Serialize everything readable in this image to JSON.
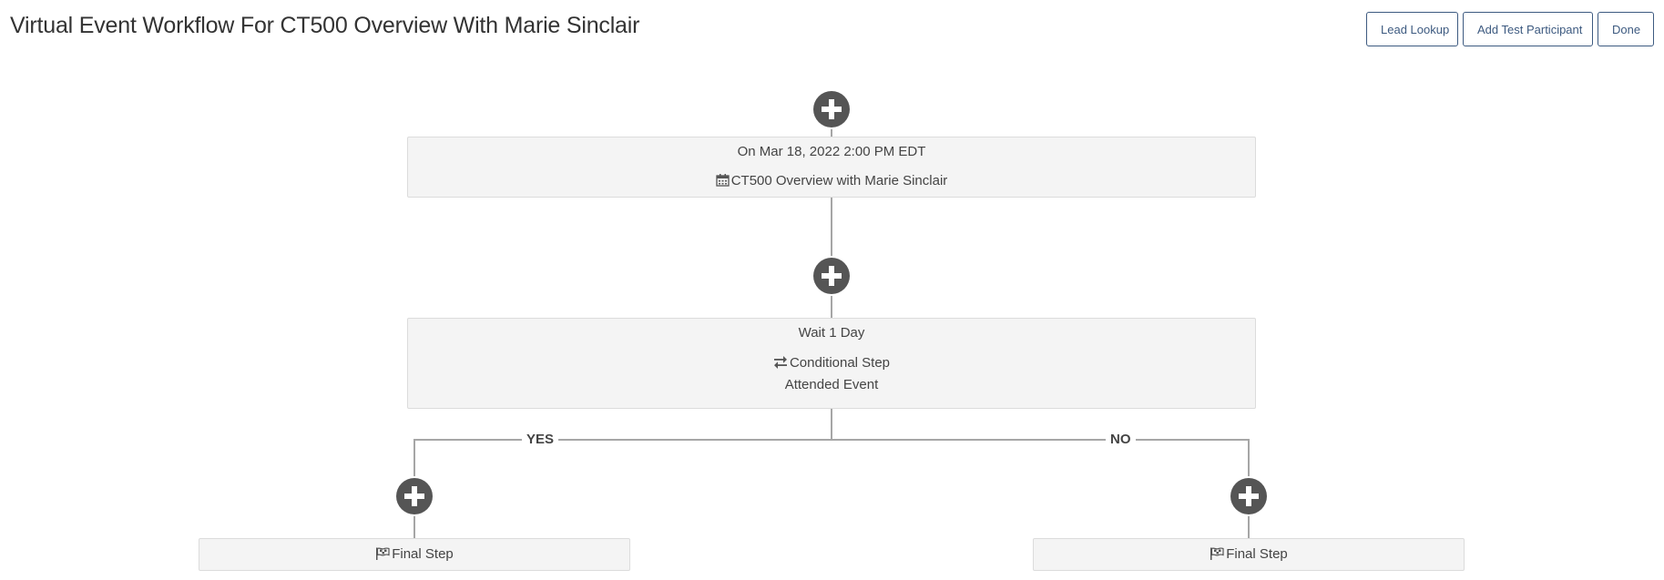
{
  "header": {
    "title": "Virtual Event Workflow For CT500 Overview With Marie Sinclair"
  },
  "toolbar": {
    "lead_lookup_label": "Lead Lookup",
    "add_test_participant_label": "Add Test Participant",
    "done_label": "Done"
  },
  "workflow": {
    "trigger_step": {
      "schedule": "On Mar 18, 2022 2:00 PM EDT",
      "event_name": "CT500 Overview with Marie Sinclair",
      "icon": "calendar-icon"
    },
    "conditional_step": {
      "wait": "Wait 1 Day",
      "type_label": "Conditional Step",
      "condition": "Attended Event",
      "icon": "exchange-icon"
    },
    "branches": {
      "yes": {
        "label": "YES",
        "final_step_label": "Final Step",
        "icon": "flag-icon"
      },
      "no": {
        "label": "NO",
        "final_step_label": "Final Step",
        "icon": "flag-icon"
      }
    },
    "add_step_icon": "plus-circle-icon"
  },
  "colors": {
    "button_border": "#3d5a80",
    "add_button": "#555555",
    "connector": "#a6a6a6",
    "step_background": "#f4f4f4"
  }
}
